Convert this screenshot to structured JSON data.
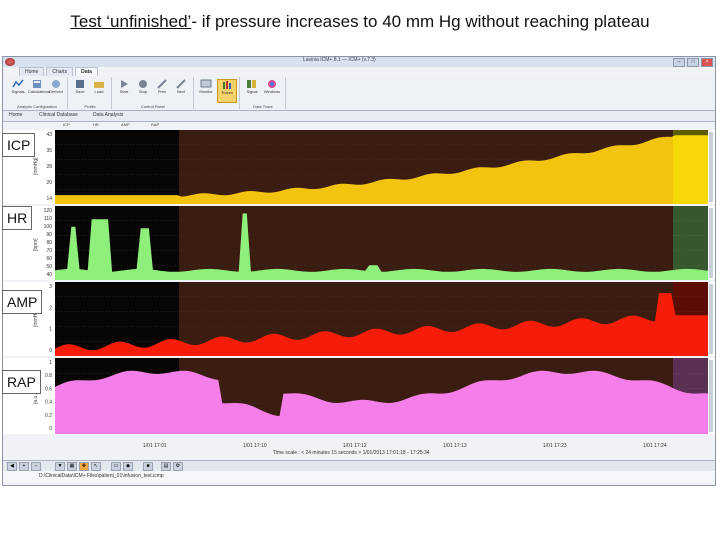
{
  "slide": {
    "title_underlined": "Test ‘unfinished’",
    "title_rest": "- if pressure increases to 40 mm Hg without reaching plateau"
  },
  "app": {
    "window_title": "Lavinia ICM+ 8.1 — ICM+ (v.7.3)",
    "ribbon_tabs": [
      "Home",
      "Charts",
      "Data"
    ],
    "ribbon_groups": [
      {
        "label": "Analysis Configuration",
        "buttons": [
          "Signals",
          "Calculations",
          "Derived"
        ]
      },
      {
        "label": "Profile",
        "buttons": [
          "Save",
          "Load"
        ]
      },
      {
        "label": "Control Panel",
        "buttons": [
          "Start",
          "Stop",
          "Prev",
          "Next"
        ]
      },
      {
        "label": "",
        "buttons": [
          "Monitor",
          "Traces"
        ]
      },
      {
        "label": "Data Trace",
        "buttons": [
          "Signal",
          "Windows"
        ]
      }
    ],
    "doc_tabs": [
      "Home",
      "Clinical Database",
      "Data Analysis"
    ],
    "column_headers": [
      "ICP",
      "HR",
      "AMP",
      "RAP"
    ],
    "time_axis": {
      "ticks": [
        "1/01 17:01",
        "1/01 17:10",
        "1/01 17:12",
        "1/01 17:13",
        "1/01 17:23",
        "1/01 17:24"
      ],
      "caption": "Time scale : < 24 minutes 15 seconds >    1/01/2013 17:01:18 - 17:25:34"
    },
    "status_path": "D:\\ClinicalData\\ICM+ Files\\patient_01\\infusion_test.icmp"
  },
  "traces": [
    {
      "label": "ICP",
      "unit": "[mmHg]",
      "ticks": [
        "43",
        "35",
        "28",
        "20",
        "14"
      ],
      "fill": "#f2c40f",
      "tail_fill": "#ffff00"
    },
    {
      "label": "HR",
      "unit": "[bpm]",
      "ticks": [
        "120",
        "110",
        "100",
        "90",
        "80",
        "70",
        "60",
        "50",
        "40"
      ],
      "fill": "#8ef07a",
      "tail_fill": "#8ef07a"
    },
    {
      "label": "AMP",
      "unit": "[mmHg]",
      "ticks": [
        "3",
        "2",
        "1",
        "0"
      ],
      "fill": "#f51d0a",
      "tail_fill": "#f51d0a"
    },
    {
      "label": "RAP",
      "unit": "[a.u.]",
      "ticks": [
        "1",
        "0.8",
        "0.6",
        "0.4",
        "0.2",
        "0"
      ],
      "fill": "#f57fe8",
      "tail_fill": "#f57fe8"
    }
  ],
  "colors": {
    "plot_bg": "#080505",
    "highlight_bg": "#3b1c10",
    "grid": "#3a3a3a"
  }
}
